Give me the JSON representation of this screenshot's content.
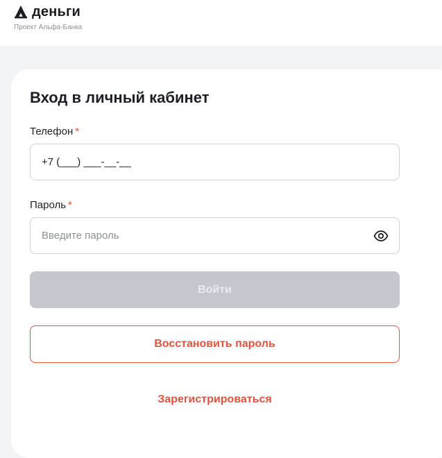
{
  "brand": {
    "name": "деньги",
    "subtitle": "Проект Альфа-Банка",
    "mark_color": "#1b1d22"
  },
  "form": {
    "title": "Вход в личный кабинет",
    "phone": {
      "label": "Телефон",
      "required_mark": "*",
      "value": "+7 (___) ___-__-__"
    },
    "password": {
      "label": "Пароль",
      "required_mark": "*",
      "placeholder": "Введите пароль",
      "toggle_icon": "eye-icon"
    },
    "login_button": "Войти",
    "restore_button": "Восстановить пароль",
    "register_link": "Зарегистрироваться"
  },
  "colors": {
    "accent": "#e0533f",
    "required": "#e74a35",
    "disabled_button": "#c4c8ce",
    "page_background": "#f3f4f5"
  }
}
